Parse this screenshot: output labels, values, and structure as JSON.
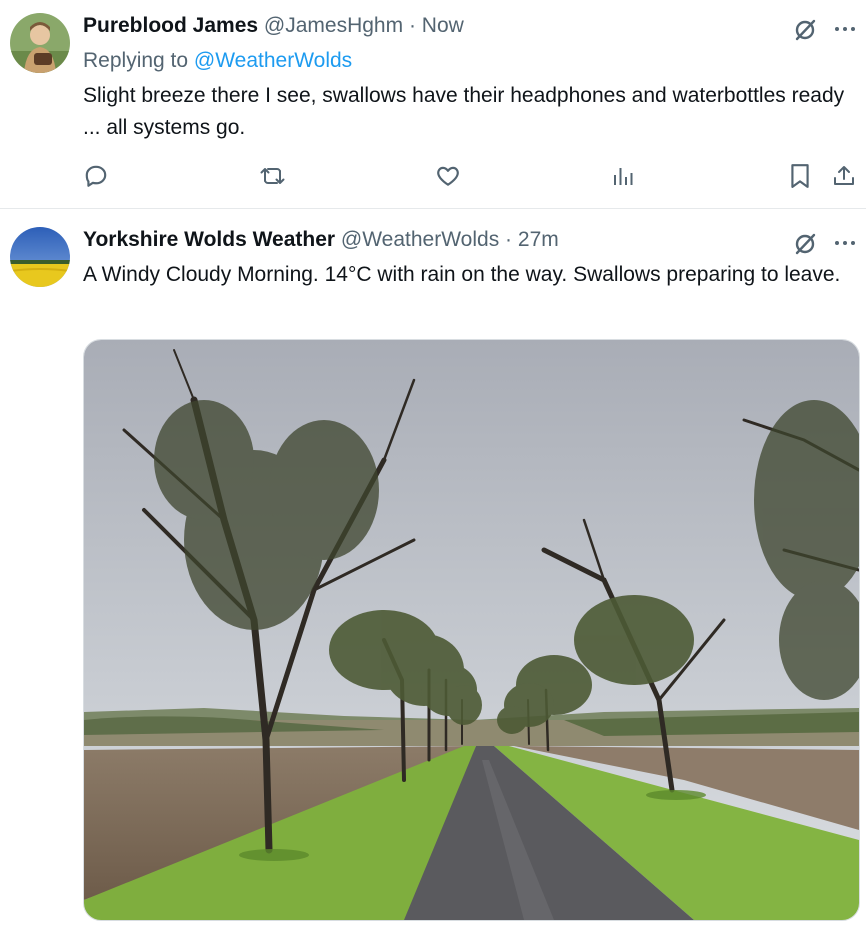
{
  "reply_tweet": {
    "display_name": "Pureblood James",
    "handle": "@JamesHghm",
    "separator": "·",
    "time": "Now",
    "replying_to_prefix": "Replying to",
    "replying_to_handle": "@WeatherWolds",
    "text": "Slight breeze there I see, swallows have their headphones and waterbottles ready ... all systems go.",
    "actions": [
      "reply-icon",
      "retweet-icon",
      "like-icon",
      "views-icon",
      "bookmark-icon",
      "share-icon"
    ]
  },
  "main_tweet": {
    "display_name": "Yorkshire Wolds Weather",
    "handle": "@WeatherWolds",
    "separator": "·",
    "time": "27m",
    "text": "A Windy Cloudy Morning. 14°C with rain on the way. Swallows preparing to leave."
  },
  "colors": {
    "text": "#0f1419",
    "muted": "#536471",
    "link": "#1d9bf0",
    "divider": "#e6e9eb"
  }
}
